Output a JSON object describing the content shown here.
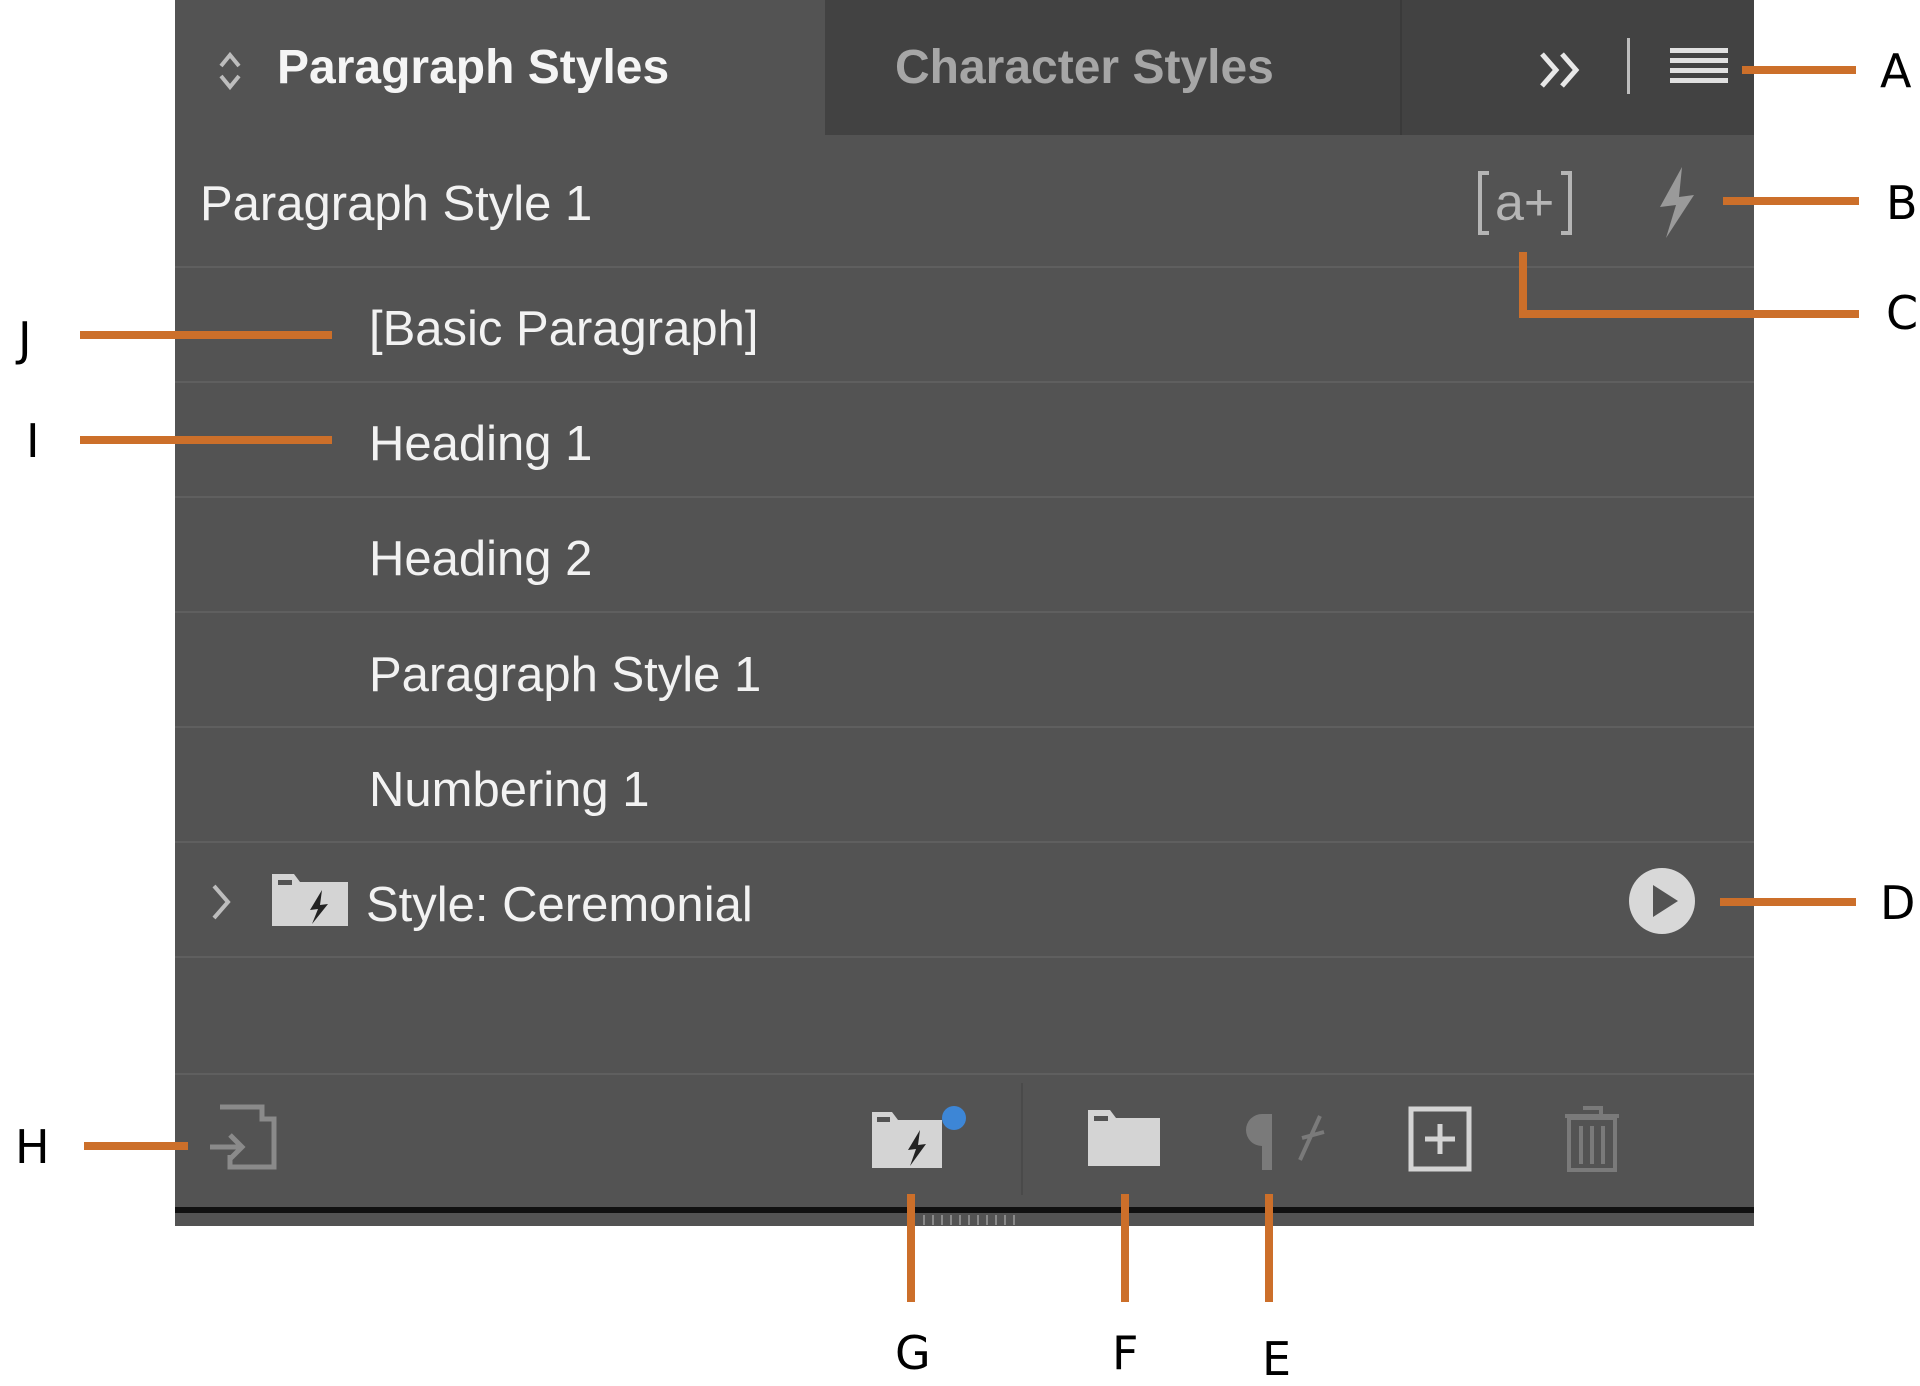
{
  "tabs": [
    {
      "label": "Paragraph Styles",
      "active": true
    },
    {
      "label": "Character Styles",
      "active": false
    }
  ],
  "header": {
    "current_style": "Paragraph Style 1"
  },
  "styles": [
    "[Basic Paragraph]",
    "Heading 1",
    "Heading 2",
    "Paragraph Style 1",
    "Numbering 1"
  ],
  "group": {
    "label": "Style: Ceremonial"
  },
  "callouts": {
    "A": "A",
    "B": "B",
    "C": "C",
    "D": "D",
    "E": "E",
    "F": "F",
    "G": "G",
    "H": "H",
    "I": "I",
    "J": "J"
  },
  "colors": {
    "panel": "#535353",
    "tabbar": "#424242",
    "leader": "#cc6f2a",
    "badge": "#3d86d6"
  }
}
